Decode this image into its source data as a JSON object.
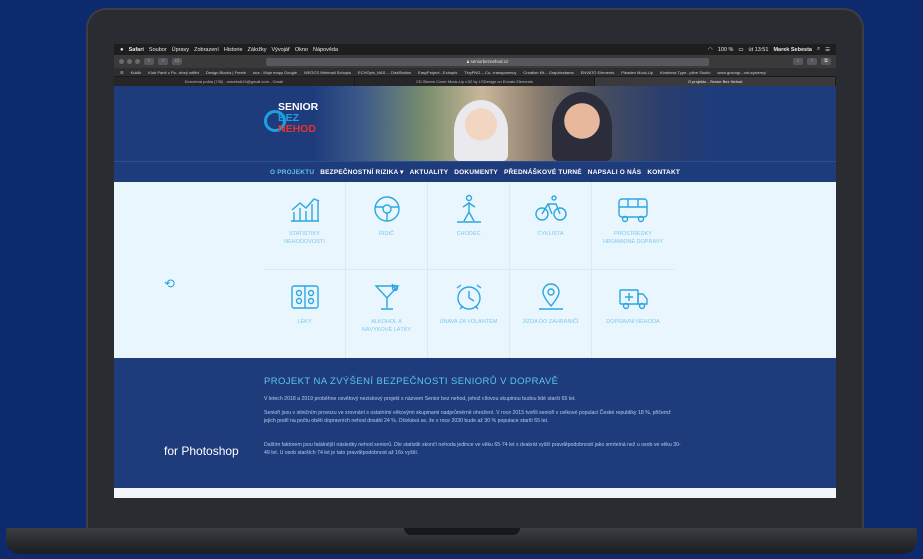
{
  "menubar": {
    "apple": "",
    "items": [
      "Safari",
      "Soubor",
      "Úpravy",
      "Zobrazení",
      "Historie",
      "Záložky",
      "Vývojář",
      "Okno",
      "Nápověda"
    ],
    "battery": "100 %",
    "clock": "út 13:51",
    "user": "Marek Sebesta"
  },
  "browser": {
    "url": "seniorbeznehod.cz",
    "bookmarks": [
      "Kuklik",
      "Klub Páně z Po...ebejí odfitrt",
      "Design Blocks | Freele",
      "tour - Moje mapy Google",
      "WEGCS Webmail Schopis",
      "ECHOpin_NAS ... DiskStation",
      "EasyProject - Echopis",
      "TinyPNG – Co...transparency",
      "Creation Kit... Graphicstama",
      "ENVATO Elements",
      "Pleaden Mock-Up",
      "Kindness Type...pline Studio",
      "www.gravogr...ont-systemy/"
    ],
    "tabs": [
      "Doručená pošta (735) - mareksb24@gmail.com - Gmail",
      "CD Sleeve Cover Mock-Up v.52 by LSDesign on Envato Elements",
      "O projektu - Senior Bez Nehod"
    ]
  },
  "logo": {
    "line1": "SENIOR",
    "line2": "BEZ",
    "line3": "NEHOD"
  },
  "nav": {
    "items": [
      {
        "label": "O PROJEKTU",
        "active": true
      },
      {
        "label": "BEZPEČNOSTNÍ RIZIKA ▾",
        "active": false
      },
      {
        "label": "AKTUALITY",
        "active": false
      },
      {
        "label": "DOKUMENTY",
        "active": false
      },
      {
        "label": "PŘEDNÁŠKOVÉ TURNÉ",
        "active": false
      },
      {
        "label": "NAPSALI O NÁS",
        "active": false
      },
      {
        "label": "KONTAKT",
        "active": false
      }
    ]
  },
  "categories": [
    {
      "label": "STATISTIKY NEHODOVOSTI",
      "icon": "chart-icon"
    },
    {
      "label": "ŘIDIČ",
      "icon": "steering-wheel-icon"
    },
    {
      "label": "CHODEC",
      "icon": "pedestrian-icon"
    },
    {
      "label": "CYKLISTA",
      "icon": "bicycle-icon"
    },
    {
      "label": "PROSTŘEDKY HROMADNÉ DOPRAVY",
      "icon": "bus-icon"
    },
    {
      "label": "LÉKY",
      "icon": "pills-icon"
    },
    {
      "label": "ALKOHOL A NÁVYKOVÉ LÁTKY",
      "icon": "cocktail-icon"
    },
    {
      "label": "ÚNAVA ZA VOLANTEM",
      "icon": "alarm-clock-icon"
    },
    {
      "label": "JÍZDA DO ZAHRANIČÍ",
      "icon": "map-pin-icon"
    },
    {
      "label": "DOPRAVNÍ NEHODA",
      "icon": "ambulance-icon"
    }
  ],
  "side_label": "for Photoshop",
  "project": {
    "title": "PROJEKT NA ZVÝŠENÍ BEZPEČNOSTI SENIORŮ V DOPRAVĚ",
    "p1": "V letech 2018 a 2019 proběhne osvětový neziskový projekt s názvem Senior bez nehod, jehož cílovou skupinou budou lidé starší 65 let.",
    "p2": "Senioři jsou v silničním provozu ve srovnání s ostatními věkovými skupinami nadprůměrně ohrožení. V roce 2015 tvořili senioři v celkové populaci České republiky 18 %, přičemž jejich podíl na počtu obětí dopravních nehod dosáhl 24 %. Očekává se, že v roce 2030 bude až 30 % populace starší 65 let.",
    "p3": "Dalším faktorem jsou fatálnější následky nehod seniorů. Dle statistik skončí nehoda jedince ve věku 65-74 let s dvakrát vyšší pravděpodobností jako smrtelná než u osob ve věku 30-49 let. U osob starších 74 let je tato pravděpodobnost až 16x vyšší."
  },
  "colors": {
    "background": "#0d2a6e",
    "site_blue": "#1e3c7c",
    "accent": "#5ec2f3",
    "icon_blue": "#2ca6e0",
    "logo_red": "#e8312f"
  }
}
